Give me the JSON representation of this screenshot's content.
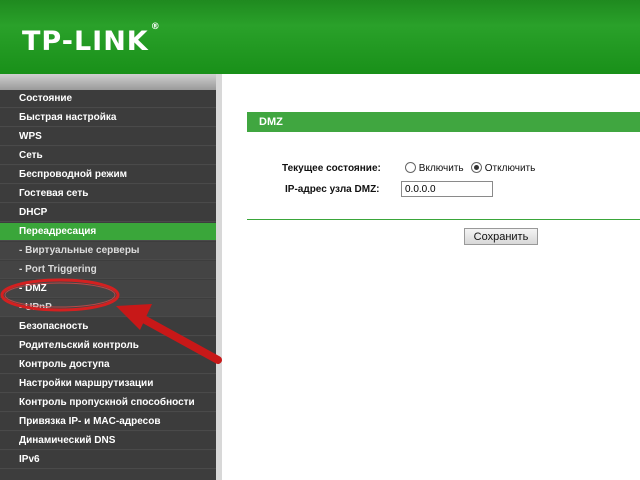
{
  "brand": {
    "logo": "TP-LINK",
    "trademark": "®"
  },
  "colors": {
    "header_green": "#2aa12a",
    "active_green": "#3aa63a",
    "sidebar_bg": "#3c3c3c",
    "annotation_red": "#d42020"
  },
  "sidebar": {
    "items": [
      {
        "label": "Состояние"
      },
      {
        "label": "Быстрая настройка"
      },
      {
        "label": "WPS"
      },
      {
        "label": "Сеть"
      },
      {
        "label": "Беспроводной режим"
      },
      {
        "label": "Гостевая сеть"
      },
      {
        "label": "DHCP"
      },
      {
        "label": "Переадресация"
      },
      {
        "label": "- Виртуальные серверы"
      },
      {
        "label": "- Port Triggering"
      },
      {
        "label": "- DMZ"
      },
      {
        "label": "- UPnP"
      },
      {
        "label": "Безопасность"
      },
      {
        "label": "Родительский контроль"
      },
      {
        "label": "Контроль доступа"
      },
      {
        "label": "Настройки маршрутизации"
      },
      {
        "label": "Контроль пропускной способности"
      },
      {
        "label": "Привязка IP- и MAC-адресов"
      },
      {
        "label": "Динамический DNS"
      },
      {
        "label": "IPv6"
      }
    ]
  },
  "main": {
    "title": "DMZ",
    "status_label": "Текущее состояние:",
    "enable_label": "Включить",
    "disable_label": "Отключить",
    "selected": "Отключить",
    "ip_label": "IP-адрес узла DMZ:",
    "ip_value": "0.0.0.0",
    "save_label": "Сохранить"
  }
}
